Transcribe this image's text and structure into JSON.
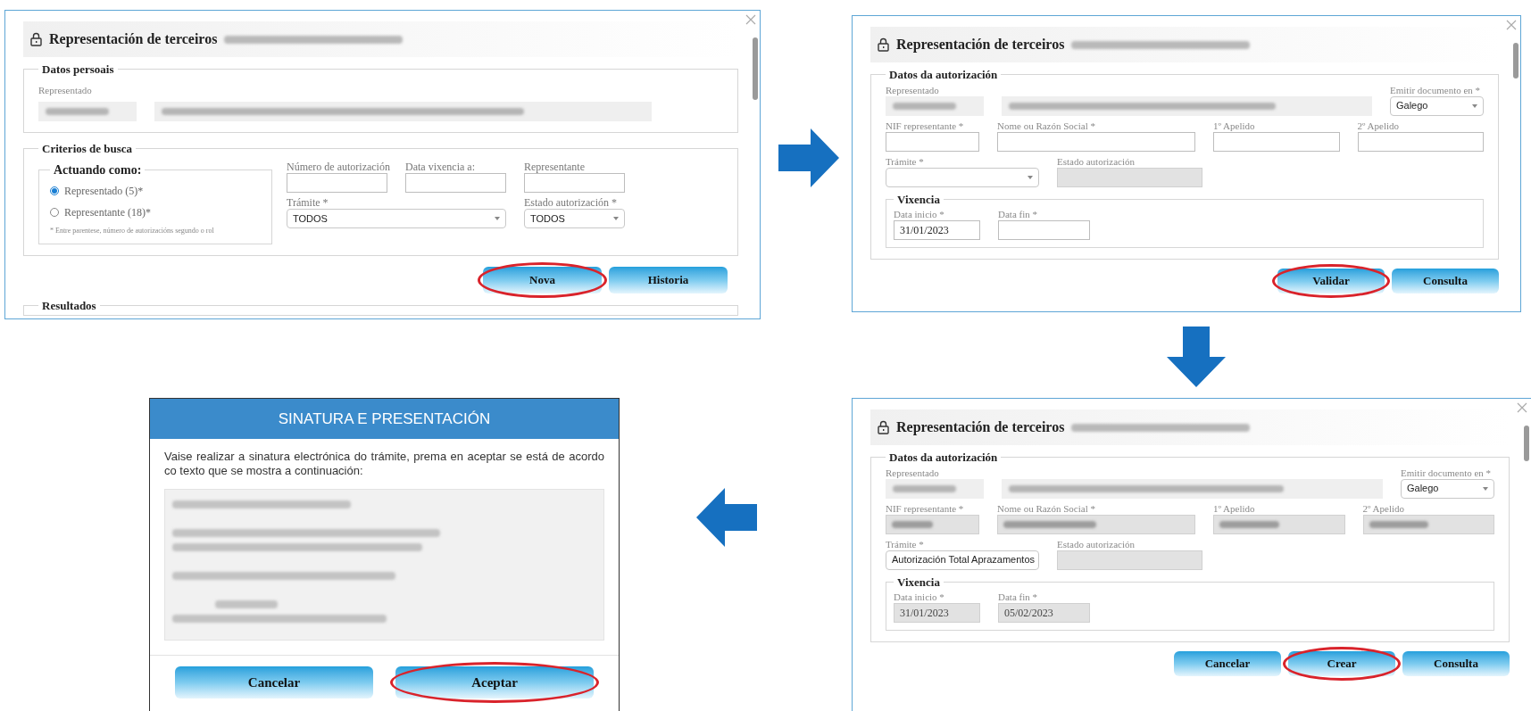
{
  "flow_arrows": [
    {
      "kind": "right"
    },
    {
      "kind": "down"
    },
    {
      "kind": "left"
    }
  ],
  "screens": [
    {
      "kind": "search",
      "title": "Representación de terceiros",
      "personal_section": {
        "legend": "Datos persoais",
        "label": "Representado"
      },
      "criteria_section": {
        "legend": "Criterios de busca",
        "role_group": {
          "legend": "Actuando como:",
          "options": [
            {
              "label": "Representado (5)*",
              "selected": true
            },
            {
              "label": "Representante (18)*",
              "selected": false
            }
          ],
          "note": "* Entre parentese, número de autorizacións segundo o rol"
        },
        "fields": [
          {
            "label": "Número de autorización",
            "kind": "text"
          },
          {
            "label": "Data vixencia a:",
            "kind": "text"
          },
          {
            "label": "Representante",
            "kind": "text"
          },
          {
            "label": "Trámite *",
            "kind": "select",
            "value": "TODOS"
          },
          {
            "label": "Estado autorización *",
            "kind": "select",
            "value": "TODOS"
          }
        ]
      },
      "buttons": [
        {
          "label": "Nova",
          "highlighted": true
        },
        {
          "label": "Historia",
          "highlighted": false
        }
      ],
      "results_section": {
        "legend": "Resultados"
      }
    },
    {
      "kind": "authorization",
      "title": "Representación de terceiros",
      "section": {
        "legend": "Datos da autorización"
      },
      "represented": {
        "label": "Representado"
      },
      "language": {
        "label": "Emitir documento en *",
        "value": "Galego"
      },
      "fields": [
        {
          "label": "NIF representante *",
          "redacted": false,
          "disabled": false
        },
        {
          "label": "Nome ou Razón Social *",
          "redacted": false,
          "disabled": false
        },
        {
          "label": "1º Apelido",
          "redacted": false,
          "disabled": false
        },
        {
          "label": "2º Apelido",
          "redacted": false,
          "disabled": false
        }
      ],
      "procedure": {
        "label": "Trámite *"
      },
      "status": {
        "label": "Estado autorización",
        "disabled": true
      },
      "validity": {
        "legend": "Vixencia",
        "start": {
          "label": "Data inicio *",
          "value": "31/01/2023",
          "disabled": false
        },
        "end": {
          "label": "Data fin *",
          "disabled": false
        }
      },
      "buttons": [
        {
          "label": "Validar",
          "highlighted": true
        },
        {
          "label": "Consulta",
          "highlighted": false
        }
      ]
    },
    {
      "kind": "authorization",
      "title": "Representación de terceiros",
      "section": {
        "legend": "Datos da autorización"
      },
      "represented": {
        "label": "Representado"
      },
      "language": {
        "label": "Emitir documento en *",
        "value": "Galego"
      },
      "fields": [
        {
          "label": "NIF representante *",
          "redacted": true,
          "disabled": true
        },
        {
          "label": "Nome ou Razón Social *",
          "redacted": true,
          "disabled": true
        },
        {
          "label": "1º Apelido",
          "redacted": true,
          "disabled": true
        },
        {
          "label": "2º Apelido",
          "redacted": true,
          "disabled": true
        }
      ],
      "procedure": {
        "label": "Trámite *",
        "value": "Autorización Total Aprazamentos"
      },
      "status": {
        "label": "Estado autorización",
        "disabled": true
      },
      "validity": {
        "legend": "Vixencia",
        "start": {
          "label": "Data inicio *",
          "value": "31/01/2023",
          "disabled": true
        },
        "end": {
          "label": "Data fin *",
          "value": "05/02/2023",
          "disabled": true
        }
      },
      "buttons": [
        {
          "label": "Cancelar",
          "highlighted": false
        },
        {
          "label": "Crear",
          "highlighted": true
        },
        {
          "label": "Consulta",
          "highlighted": false
        }
      ]
    },
    {
      "kind": "signature_dialog",
      "title": "SINATURA E PRESENTACIÓN",
      "message": "Vaise realizar a sinatura electrónica do trámite, prema en aceptar se está de acordo co texto que se mostra a continuación:",
      "buttons": [
        {
          "label": "Cancelar",
          "highlighted": false
        },
        {
          "label": "Aceptar",
          "highlighted": true
        }
      ]
    }
  ]
}
